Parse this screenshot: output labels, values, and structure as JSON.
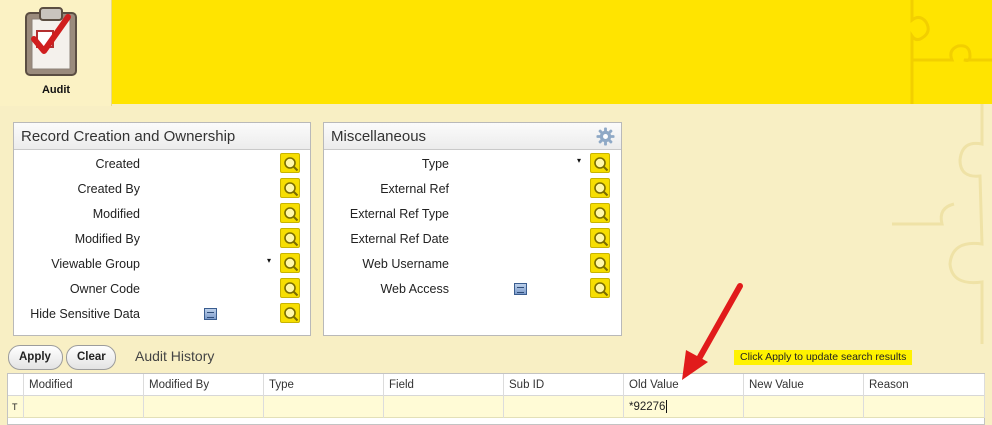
{
  "app": {
    "tab_label": "Audit",
    "accent_color": "#ffe400"
  },
  "panel_record": {
    "title": "Record Creation and Ownership",
    "fields": [
      {
        "label": "Created",
        "control": "search"
      },
      {
        "label": "Created By",
        "control": "search"
      },
      {
        "label": "Modified",
        "control": "search"
      },
      {
        "label": "Modified By",
        "control": "search"
      },
      {
        "label": "Viewable Group",
        "control": "dropdown"
      },
      {
        "label": "Owner Code",
        "control": "search"
      },
      {
        "label": "Hide Sensitive Data",
        "control": "checkbox"
      }
    ]
  },
  "panel_misc": {
    "title": "Miscellaneous",
    "fields": [
      {
        "label": "Type",
        "control": "dropdown"
      },
      {
        "label": "External Ref",
        "control": "search"
      },
      {
        "label": "External Ref Type",
        "control": "search"
      },
      {
        "label": "External Ref Date",
        "control": "search"
      },
      {
        "label": "Web Username",
        "control": "search"
      },
      {
        "label": "Web Access",
        "control": "checkbox"
      }
    ]
  },
  "toolbar": {
    "apply_label": "Apply",
    "clear_label": "Clear",
    "section_title": "Audit History",
    "hint": "Click Apply to update search results"
  },
  "grid": {
    "columns": [
      "Modified",
      "Modified By",
      "Type",
      "Field",
      "Sub ID",
      "Old Value",
      "New Value",
      "Reason"
    ],
    "filter_symbol": "T",
    "filter_values": [
      "",
      "",
      "",
      "",
      "",
      "*92276",
      "",
      ""
    ]
  }
}
